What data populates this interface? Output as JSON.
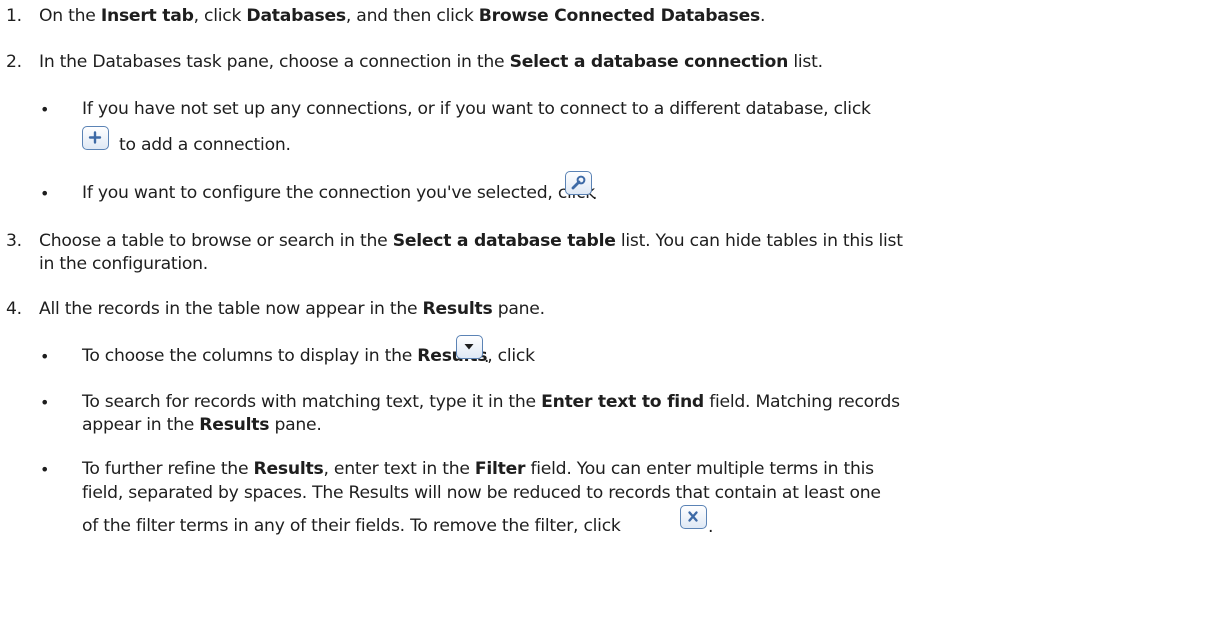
{
  "steps": [
    {
      "number": "1.",
      "parts": [
        "On the ",
        "Insert tab",
        ", click ",
        "Databases",
        ", and then click ",
        "Browse Connected Databases",
        "."
      ]
    },
    {
      "number": "2.",
      "parts": [
        "In the Databases task pane, choose a connection in the ",
        "Select a database connection",
        " list."
      ],
      "bullets": [
        {
          "line1": "If you have not set up any connections, or if you want to connect to a different database, click",
          "line2": "to add a connection.",
          "icon": "plus-icon"
        },
        {
          "text": "If you want to configure the connection you've selected, click",
          "after": ".",
          "icon": "wrench-icon"
        }
      ]
    },
    {
      "number": "3.",
      "parts": [
        "Choose a table to browse or search in the ",
        "Select a database table",
        " list. You can hide tables in this list"
      ],
      "line2": "in the configuration."
    },
    {
      "number": "4.",
      "parts": [
        "All the records in the table now appear in the ",
        "Results",
        " pane."
      ],
      "bullets": [
        {
          "parts": [
            "To choose the columns to display in the ",
            "Results",
            ", click"
          ],
          "after": ".",
          "icon": "dropdown-arrow-icon"
        },
        {
          "parts": [
            "To search for records with matching text, type it in the ",
            "Enter text to find",
            " field. Matching records"
          ],
          "line2_parts": [
            "appear in the ",
            "Results",
            " pane."
          ]
        },
        {
          "parts": [
            "To further refine the ",
            "Results",
            ", enter text in the ",
            "Filter",
            " field. You can enter multiple terms in this"
          ],
          "line2": "field, separated by spaces. The Results will now be reduced to records that contain at least one",
          "line3": "of the filter terms in any of their fields. To remove the filter, click",
          "after": ".",
          "icon": "clear-filter-icon"
        }
      ]
    }
  ],
  "bullet_glyph": "•"
}
